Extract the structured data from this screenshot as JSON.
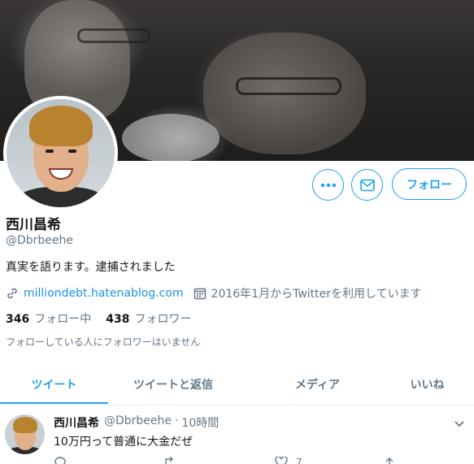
{
  "profile": {
    "name": "西川昌希",
    "handle": "@Dbrbeehe",
    "bio": "真実を語ります。逮捕されました",
    "website": "milliondebt.hatenablog.com",
    "joined": "2016年1月からTwitterを利用しています",
    "following_count": "346",
    "following_label": "フォロー中",
    "followers_count": "438",
    "followers_label": "フォロワー",
    "followed_by_note": "フォローしている人にフォロワーはいません"
  },
  "actions": {
    "follow_label": "フォロー",
    "more_icon": "more-icon",
    "message_icon": "mail-icon"
  },
  "tabs": [
    {
      "label": "ツイート"
    },
    {
      "label": "ツイートと返信"
    },
    {
      "label": "メディア"
    },
    {
      "label": "いいね"
    }
  ],
  "tweet": {
    "author_name": "西川昌希",
    "author_handle": "@Dbrbeehe",
    "separator": "·",
    "time": "10時間",
    "text": "10万円って普通に大金だぜ",
    "like_count": "7"
  },
  "colors": {
    "accent": "#1da1f2",
    "link": "#1b95e0",
    "muted": "#657786"
  }
}
